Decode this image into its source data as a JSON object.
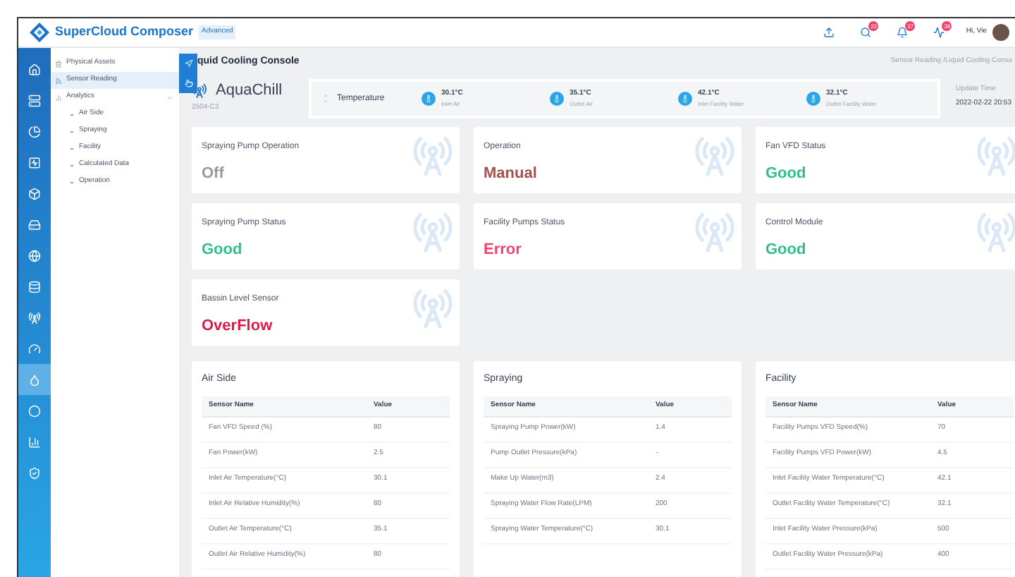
{
  "header": {
    "brand": "SuperCloud Composer",
    "edition": "Advanced",
    "actions": [
      {
        "kind": "upload"
      },
      {
        "kind": "search",
        "count": "22"
      },
      {
        "kind": "bell",
        "count": "37"
      },
      {
        "kind": "activity",
        "count": "38"
      }
    ],
    "greeting": "Hi, Vie"
  },
  "rail": [
    {
      "kind": "home",
      "selected": false
    },
    {
      "kind": "server",
      "selected": false
    },
    {
      "kind": "pie",
      "selected": false
    },
    {
      "kind": "chart",
      "selected": false
    },
    {
      "kind": "box",
      "selected": false
    },
    {
      "kind": "drive",
      "selected": false
    },
    {
      "kind": "globe",
      "selected": false
    },
    {
      "kind": "database",
      "selected": false
    },
    {
      "kind": "tower",
      "selected": false
    },
    {
      "kind": "gauge",
      "selected": false
    },
    {
      "kind": "drop",
      "selected": true
    },
    {
      "kind": "circle",
      "selected": false
    },
    {
      "kind": "bars",
      "selected": false
    },
    {
      "kind": "shield",
      "selected": false
    }
  ],
  "sidebar": {
    "items": [
      {
        "label": "Physical Assets",
        "kind": "trash",
        "selected": false
      },
      {
        "label": "Sensor Reading",
        "kind": "sensor",
        "selected": true
      },
      {
        "label": "Analytics",
        "kind": "bars",
        "selected": false,
        "expanded": true,
        "children": [
          {
            "label": "Air Side"
          },
          {
            "label": "Spraying"
          },
          {
            "label": "Facility"
          },
          {
            "label": "Calculated Data"
          },
          {
            "label": "Operation"
          }
        ]
      }
    ]
  },
  "page": {
    "title": "quid Cooling Console",
    "breadcrumb": "Sensor Reading /Liquid Cooling Conso"
  },
  "device": {
    "name": "AquaChill",
    "model": "2504-C3"
  },
  "sensor_strip": {
    "label": "Temperature",
    "readings": [
      {
        "value": "30.1°C",
        "label": "Inlet Air"
      },
      {
        "value": "35.1°C",
        "label": "Outlet Air"
      },
      {
        "value": "42.1°C",
        "label": "Inlet Facility Water"
      },
      {
        "value": "32.1°C",
        "label": "Outlet Facility Water"
      }
    ]
  },
  "update": {
    "label": "Update Time",
    "time": "2022-02-22 20:53"
  },
  "status_cards": [
    {
      "title": "Spraying Pump Operation",
      "value": "Off",
      "color": "#9a9a9a"
    },
    {
      "title": "Operation",
      "value": "Manual",
      "color": "#a5524f"
    },
    {
      "title": "Fan VFD Status",
      "value": "Good",
      "color": "#2dc08d"
    },
    {
      "title": "Spraying Pump Status",
      "value": "Good",
      "color": "#2dc08d"
    },
    {
      "title": "Facility Pumps Status",
      "value": "Error",
      "color": "#f2416f"
    },
    {
      "title": "Control Module",
      "value": "Good",
      "color": "#2dc08d"
    },
    {
      "title": "Bassin Level Sensor",
      "value": "OverFlow",
      "color": "#e0174a"
    }
  ],
  "tables": [
    {
      "title": "Air Side",
      "columns": [
        "Sensor Name",
        "Value"
      ],
      "rows": [
        [
          "Fan VFD Speed (%)",
          "80"
        ],
        [
          "Fan Power(kW)",
          "2.5"
        ],
        [
          "Inlet Air Temperature(°C)",
          "30.1"
        ],
        [
          "Inlet Air Relative Humidity(%)",
          "80"
        ],
        [
          "Outlet Air Temperature(°C)",
          "35.1"
        ],
        [
          "Outlet Air Relative Humidity(%)",
          "80"
        ]
      ]
    },
    {
      "title": "Spraying",
      "columns": [
        "Sensor Name",
        "Value"
      ],
      "rows": [
        [
          "Spraying Pump Power(kW)",
          "1.4"
        ],
        [
          "Pump Outlet Pressure(kPa)",
          "-"
        ],
        [
          "Make Up Water(m3)",
          "2.4"
        ],
        [
          "Spraying Water Flow Rate(LPM)",
          "200"
        ],
        [
          "Spraying Water Temperature(°C)",
          "30.1"
        ]
      ]
    },
    {
      "title": "Facility",
      "columns": [
        "Sensor Name",
        "Value"
      ],
      "rows": [
        [
          "Facility Pumps VFD Speed(%)",
          "70"
        ],
        [
          "Facility Pumps VFD Power(kW)",
          "4.5"
        ],
        [
          "Inlet Facility Water Temperature(°C)",
          "42.1"
        ],
        [
          "Outlet Facility Water Temperature(°C)",
          "32.1"
        ],
        [
          "Inlet Facility Water Pressure(kPa)",
          "500"
        ],
        [
          "Outlet Facility Water Pressure(kPa)",
          "400"
        ]
      ]
    }
  ]
}
